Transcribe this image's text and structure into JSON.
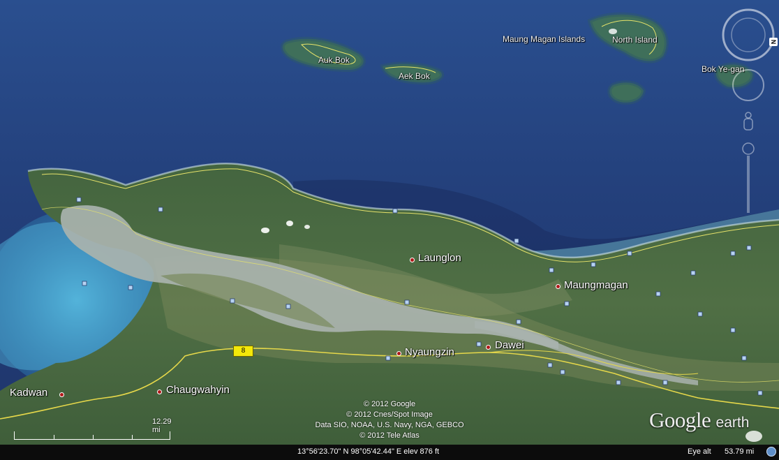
{
  "map": {
    "places": [
      {
        "key": "launglon",
        "name": "Launglon",
        "size": "big"
      },
      {
        "key": "maungmagan",
        "name": "Maungmagan",
        "size": "big"
      },
      {
        "key": "dawei",
        "name": "Dawei",
        "size": "big"
      },
      {
        "key": "nyaungzin",
        "name": "Nyaungzin",
        "size": "big"
      },
      {
        "key": "chaugwahyin",
        "name": "Chaugwahyin",
        "size": "big"
      },
      {
        "key": "kadwan",
        "name": "Kadwan",
        "size": "big"
      }
    ],
    "islands": [
      {
        "key": "auk-bok",
        "name": "Auk Bok"
      },
      {
        "key": "aek-bok",
        "name": "Aek Bok"
      },
      {
        "key": "maung-magan-islands",
        "name": "Maung Magan Islands"
      },
      {
        "key": "north-island",
        "name": "North Island"
      },
      {
        "key": "bok-ye-gan",
        "name": "Bok Ye-gan"
      }
    ],
    "route_number": "8",
    "credits": [
      "© 2012 Google",
      "© 2012 Cnes/Spot Image",
      "Data SIO, NOAA, U.S. Navy, NGA, GEBCO",
      "© 2012 Tele Atlas"
    ],
    "scale_label": "12.29 mi",
    "logo_google": "Google",
    "logo_earth": "earth",
    "compass_letter": "N",
    "colors": {
      "ocean": "#2d4d8a",
      "land": "#4b6a44",
      "river": "#9aa8a8",
      "border": "#e7e36a",
      "place_dot": "#b01818"
    }
  },
  "status": {
    "coords": "13°56'23.70\" N  98°05'42.44\" E  elev   876 ft",
    "eye_alt_label": "Eye alt",
    "eye_alt_value": "53.79 mi"
  }
}
